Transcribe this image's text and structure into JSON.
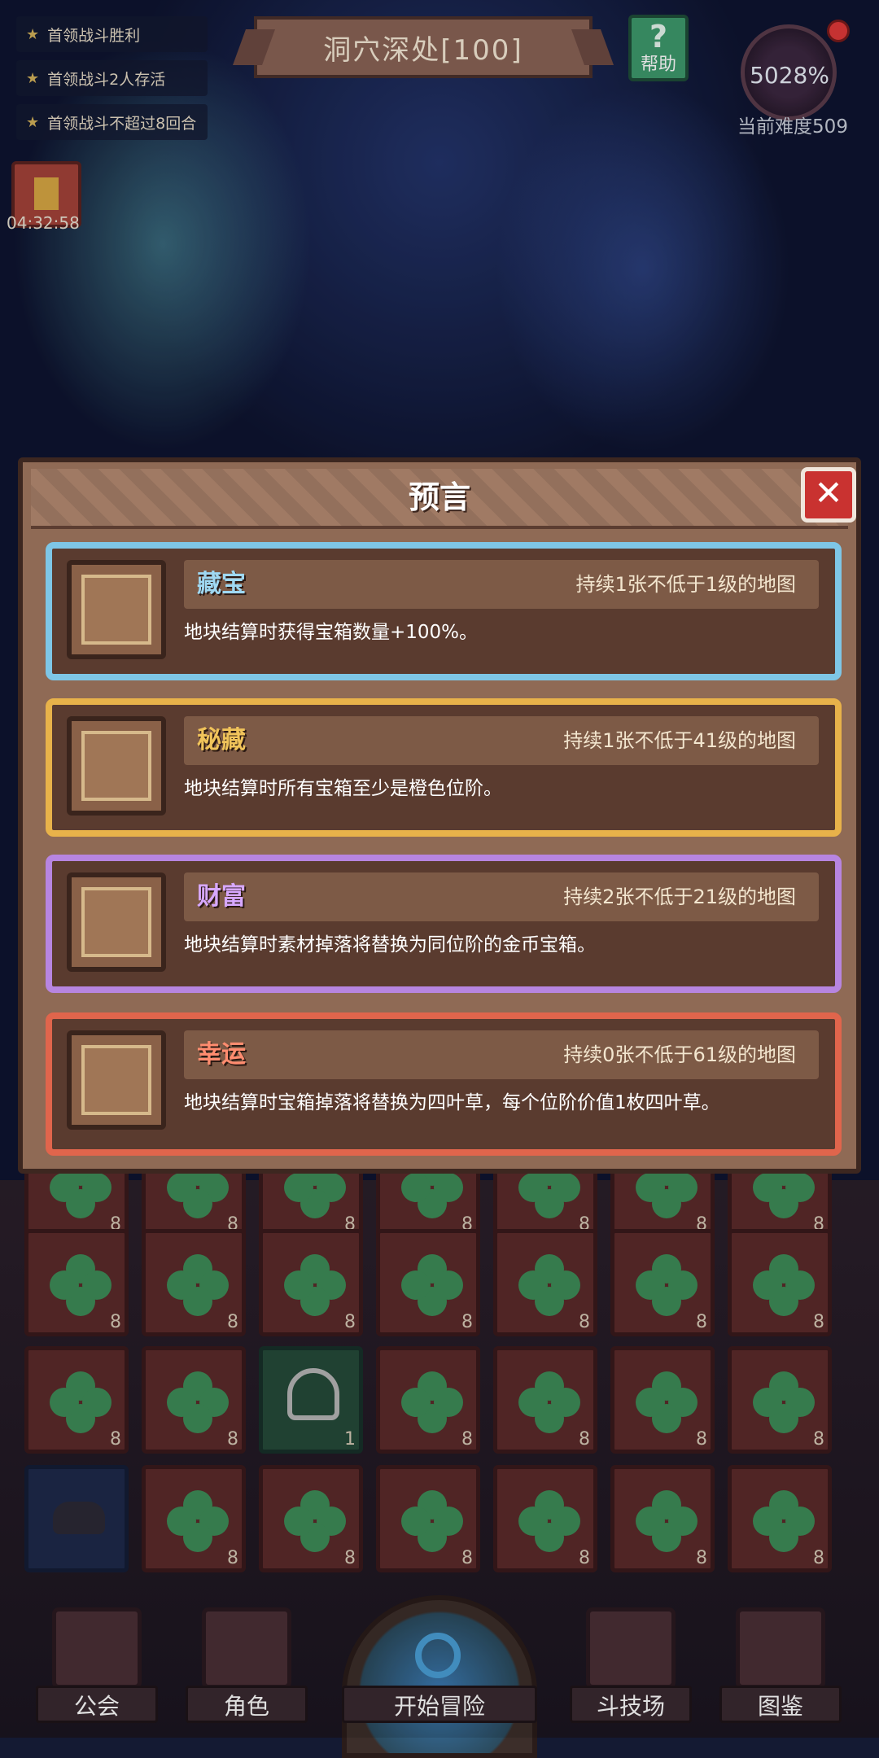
{
  "hud": {
    "objectives": [
      "首领战斗胜利",
      "首领战斗2人存活",
      "首领战斗不超过8回合"
    ],
    "stage_title": "洞穴深处[100]",
    "help_label": "帮助",
    "difficulty_percent": "5028%",
    "difficulty_label": "当前难度509",
    "gift_timer": "04:32:58"
  },
  "modal": {
    "title": "预言",
    "close_icon": "close-icon",
    "cards": [
      {
        "name": "藏宝",
        "duration": "持续1张不低于1级的地图",
        "desc": "地块结算时获得宝箱数量+100%。",
        "color": "#7ec6e6",
        "icon": "treasure-scroll-icon"
      },
      {
        "name": "秘藏",
        "duration": "持续1张不低于41级的地图",
        "desc": "地块结算时所有宝箱至少是橙色位阶。",
        "color": "#e8b24a",
        "icon": "treasure-scroll-icon"
      },
      {
        "name": "财富",
        "duration": "持续2张不低于21级的地图",
        "desc": "地块结算时素材掉落将替换为同位阶的金币宝箱。",
        "color": "#b785e0",
        "icon": "gold-coins-icon"
      },
      {
        "name": "幸运",
        "duration": "持续0张不低于61级的地图",
        "desc": "地块结算时宝箱掉落将替换为四叶草，每个位阶价值1枚四叶草。",
        "color": "#e0654c",
        "icon": "four-leaf-clover-icon"
      }
    ]
  },
  "board": {
    "row1_counts": [
      "8",
      "8",
      "8",
      "8",
      "8",
      "8",
      "8"
    ],
    "row2_counts": [
      "8",
      "8",
      "8",
      "8",
      "8",
      "8",
      "8"
    ],
    "row3_counts": [
      "8",
      "8",
      "1",
      "8",
      "8",
      "8",
      "8"
    ],
    "row4_counts": [
      "",
      "8",
      "8",
      "8",
      "8",
      "8",
      "8"
    ]
  },
  "nav": {
    "guild": "公会",
    "character": "角色",
    "start": "开始冒险",
    "arena": "斗技场",
    "codex": "图鉴"
  }
}
